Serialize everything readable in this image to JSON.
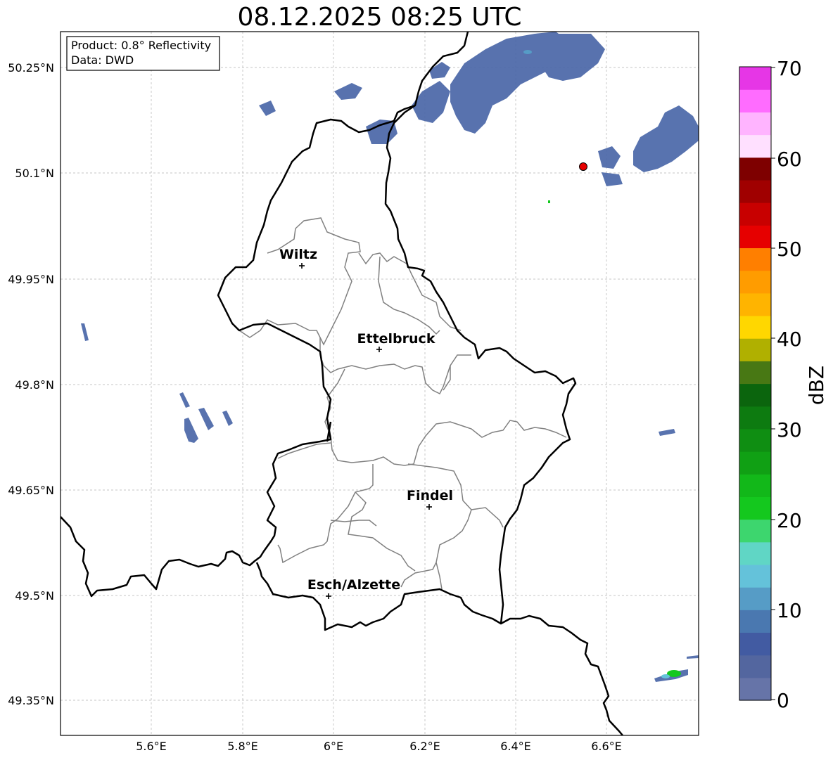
{
  "title": "08.12.2025 08:25 UTC",
  "infobox": {
    "product": "Product: 0.8° Reflectivity",
    "data": "Data: DWD"
  },
  "lat_ticks": [
    "50.25°N",
    "50.1°N",
    "49.95°N",
    "49.8°N",
    "49.65°N",
    "49.5°N",
    "49.35°N"
  ],
  "lon_ticks": [
    "5.6°E",
    "5.8°E",
    "6°E",
    "6.2°E",
    "6.4°E",
    "6.6°E"
  ],
  "cities": [
    "Wiltz",
    "Ettelbruck",
    "Findel",
    "Esch/Alzette"
  ],
  "colorbar": {
    "label": "dBZ",
    "ticks": [
      "0",
      "10",
      "20",
      "30",
      "40",
      "50",
      "60",
      "70"
    ],
    "colors": [
      "#6674a8",
      "#53669f",
      "#425ba2",
      "#4a78b0",
      "#569cc6",
      "#64c2da",
      "#60d6c5",
      "#3dd66e",
      "#14c81e",
      "#12b819",
      "#10a014",
      "#0f8e12",
      "#0d7b10",
      "#0b650d",
      "#487814",
      "#b0b000",
      "#ffd700",
      "#ffb400",
      "#ff9c00",
      "#ff7f00",
      "#e60000",
      "#c80000",
      "#a00000",
      "#7e0000",
      "#ffe0ff",
      "#ffb4ff",
      "#ff6cff",
      "#e636e6"
    ]
  },
  "accent_colors": {
    "radar_echo": "#4a67a8",
    "site_marker": "#e60000",
    "country_border": "#000000",
    "canton_border": "#808080",
    "grid": "#b4b4b4"
  }
}
